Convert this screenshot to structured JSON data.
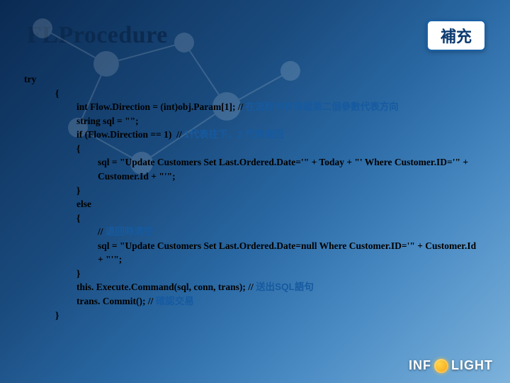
{
  "header": {
    "title": "FLProcedure",
    "tag": "補充"
  },
  "code": {
    "l0": "try",
    "l1": "{",
    "l2a": "int Flow.Direction = (int)obj.Param[1]; // ",
    "l2b": "在流程中有傳遞第二個參數代表方向",
    "l3": "string sql = \"\";",
    "l4a": "if (Flow.Direction == 1)  // ",
    "l4b": "1代表往下，2 代表退回",
    "l5": "{",
    "l6": "sql = \"Update Customers Set Last.Ordered.Date='\" + Today + \"' Where Customer.ID='\" + Customer.Id + \"'\";",
    "l7": "}",
    "l8": "else",
    "l9": "{",
    "l10a": "// ",
    "l10b": "退回時清空",
    "l11": "sql = \"Update Customers Set Last.Ordered.Date=null Where Customer.ID='\" + Customer.Id + \"'\";",
    "l12": "}",
    "l13a": "this. Execute.Command(sql, conn, trans); // ",
    "l13b": "送出SQL語句",
    "l14a": "trans. Commit(); // ",
    "l14b": "確認交易",
    "l15": "}"
  },
  "brand": {
    "left": "INF",
    "right": "LIGHT"
  }
}
